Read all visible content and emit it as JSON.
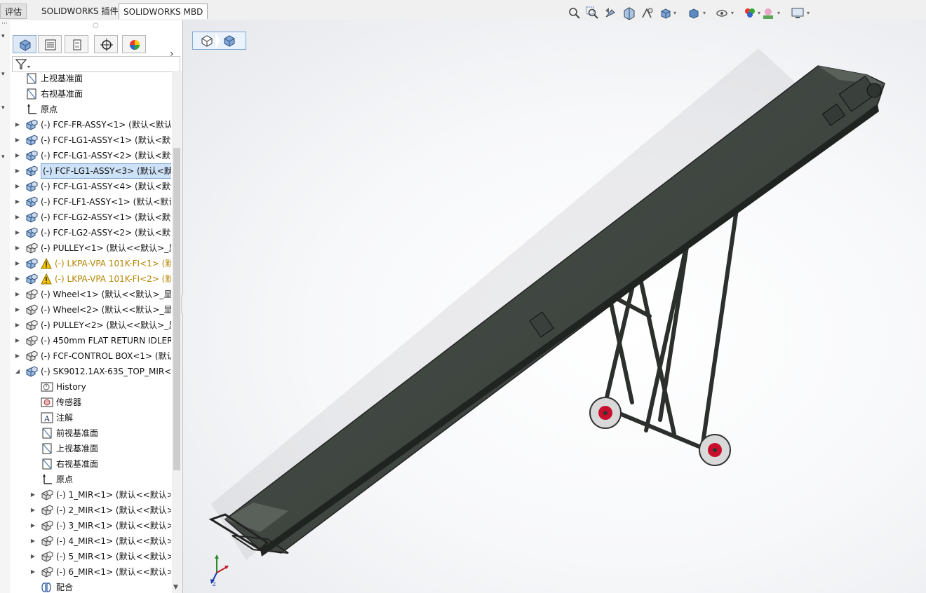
{
  "topbar": {
    "tabs": [
      {
        "label": "评估"
      },
      {
        "label": "SOLIDWORKS 插件"
      },
      {
        "label": "SOLIDWORKS MBD"
      }
    ],
    "view_icons": [
      "zoom-to-fit-icon",
      "zoom-to-area-icon",
      "previous-view-icon",
      "section-view-icon",
      "dynamic-annotation-icon",
      "view-orientation-icon",
      "display-style-icon",
      "hide-show-icon",
      "edit-appearance-icon",
      "apply-scene-icon",
      "view-settings-icon"
    ]
  },
  "panel": {
    "tabs": [
      "feature-manager-tab",
      "property-manager-tab",
      "configuration-manager-tab",
      "dimxpert-tab",
      "display-manager-tab"
    ],
    "tree": [
      {
        "label": "上视基准面",
        "indent": 1,
        "icon": "plane-icon",
        "expand": false
      },
      {
        "label": "右视基准面",
        "indent": 1,
        "icon": "plane-icon",
        "expand": false
      },
      {
        "label": "原点",
        "indent": 1,
        "icon": "origin-icon",
        "expand": false
      },
      {
        "label": "(-) FCF-FR-ASSY<1> (默认<默认_",
        "indent": 1,
        "icon": "assembly-icon",
        "expand": true
      },
      {
        "label": "(-) FCF-LG1-ASSY<1> (默认<默认",
        "indent": 1,
        "icon": "assembly-icon",
        "expand": true
      },
      {
        "label": "(-) FCF-LG1-ASSY<2> (默认<默认",
        "indent": 1,
        "icon": "assembly-icon",
        "expand": true
      },
      {
        "label": "(-) FCF-LG1-ASSY<3> (默认<默认",
        "indent": 1,
        "icon": "assembly-icon",
        "expand": true,
        "selected": true
      },
      {
        "label": "(-) FCF-LG1-ASSY<4> (默认<默认",
        "indent": 1,
        "icon": "assembly-icon",
        "expand": true
      },
      {
        "label": "(-) FCF-LF1-ASSY<1> (默认<默认",
        "indent": 1,
        "icon": "assembly-icon",
        "expand": true
      },
      {
        "label": "(-) FCF-LG2-ASSY<1> (默认<默认",
        "indent": 1,
        "icon": "assembly-icon",
        "expand": true
      },
      {
        "label": "(-) FCF-LG2-ASSY<2> (默认<默认",
        "indent": 1,
        "icon": "assembly-icon",
        "expand": true
      },
      {
        "label": "(-) PULLEY<1> (默认<<默认>_显",
        "indent": 1,
        "icon": "part-icon",
        "expand": true
      },
      {
        "label": "(-) LKPA-VPA 101K-FI<1> (默",
        "indent": 1,
        "icon": "assembly-icon",
        "expand": true,
        "warning": true
      },
      {
        "label": "(-) LKPA-VPA 101K-FI<2> (默",
        "indent": 1,
        "icon": "assembly-icon",
        "expand": true,
        "warning": true
      },
      {
        "label": "(-) Wheel<1> (默认<<默认>_显示",
        "indent": 1,
        "icon": "part-icon",
        "expand": true
      },
      {
        "label": "(-) Wheel<2> (默认<<默认>_显示",
        "indent": 1,
        "icon": "part-icon",
        "expand": true
      },
      {
        "label": "(-) PULLEY<2> (默认<<默认>_显",
        "indent": 1,
        "icon": "part-icon",
        "expand": true
      },
      {
        "label": "(-) 450mm FLAT RETURN IDLER",
        "indent": 1,
        "icon": "part-icon",
        "expand": true
      },
      {
        "label": "(-) FCF-CONTROL BOX<1> (默认",
        "indent": 1,
        "icon": "part-icon",
        "expand": true
      },
      {
        "label": "(-) SK9012.1AX-63S_TOP_MIR<1",
        "indent": 1,
        "icon": "assembly-icon",
        "expand": true,
        "open": true
      },
      {
        "label": "History",
        "indent": 2,
        "icon": "history-icon",
        "expand": false
      },
      {
        "label": "传感器",
        "indent": 2,
        "icon": "sensor-icon",
        "expand": false
      },
      {
        "label": "注解",
        "indent": 2,
        "icon": "annotation-icon",
        "expand": false
      },
      {
        "label": "前视基准面",
        "indent": 2,
        "icon": "plane-icon",
        "expand": false
      },
      {
        "label": "上视基准面",
        "indent": 2,
        "icon": "plane-icon",
        "expand": false
      },
      {
        "label": "右视基准面",
        "indent": 2,
        "icon": "plane-icon",
        "expand": false
      },
      {
        "label": "原点",
        "indent": 2,
        "icon": "origin-icon",
        "expand": false
      },
      {
        "label": "(-) 1_MIR<1> (默认<<默认>_",
        "indent": 2,
        "icon": "part-icon",
        "expand": true
      },
      {
        "label": "(-) 2_MIR<1> (默认<<默认>_",
        "indent": 2,
        "icon": "part-icon",
        "expand": true
      },
      {
        "label": "(-) 3_MIR<1> (默认<<默认>_",
        "indent": 2,
        "icon": "part-icon",
        "expand": true
      },
      {
        "label": "(-) 4_MIR<1> (默认<<默认>_",
        "indent": 2,
        "icon": "part-icon",
        "expand": true
      },
      {
        "label": "(-) 5_MIR<1> (默认<<默认>_",
        "indent": 2,
        "icon": "part-icon",
        "expand": true
      },
      {
        "label": "(-) 6_MIR<1> (默认<<默认>_",
        "indent": 2,
        "icon": "part-icon",
        "expand": true
      },
      {
        "label": "配合",
        "indent": 2,
        "icon": "mates-icon",
        "expand": false
      }
    ]
  },
  "colors": {
    "belt": "#3f4640",
    "frame": "#2c322d",
    "wheel_hub": "#c8102e",
    "selection": "#cde2f7",
    "warning_text": "#b58400"
  }
}
